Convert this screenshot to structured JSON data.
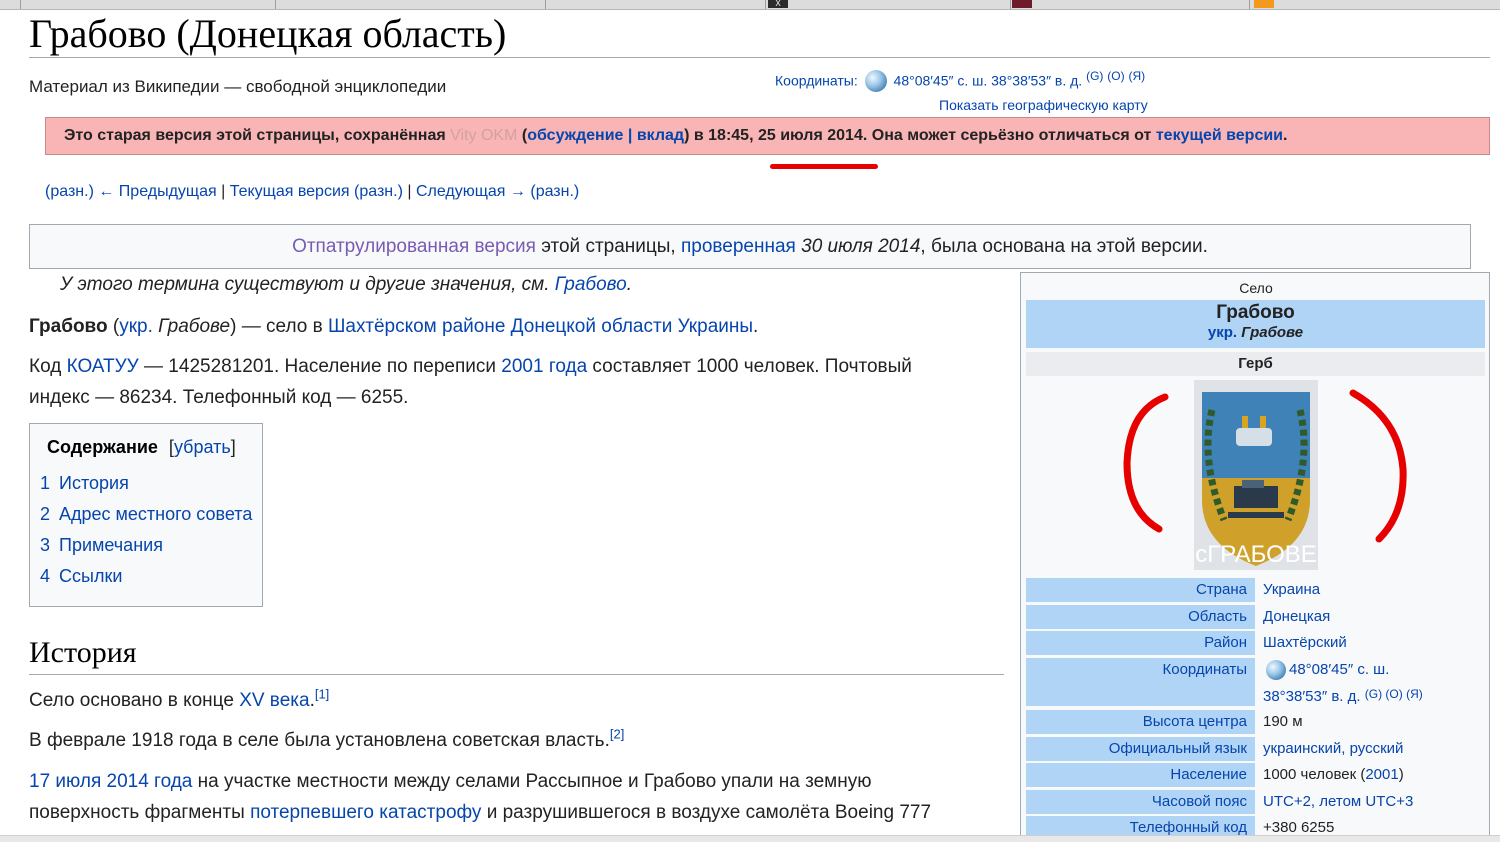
{
  "page": {
    "title": "Грабово (Донецкая область)",
    "subtitle": "Материал из Википедии — свободной энциклопедии"
  },
  "coords": {
    "label": "Координаты:",
    "value": "48°08′45″ с. ш. 38°38′53″ в. д.",
    "g": "(G)",
    "o": "(O)",
    "ya": "(Я)",
    "map_link": "Показать географическую карту"
  },
  "old_revision": {
    "prefix": "Это старая версия этой страницы, сохранённая",
    "user": "Vity OKM",
    "open_paren": " (",
    "talk": "обсуждение",
    "sep": " | ",
    "contribs": "вклад",
    "time_text": ") в 18:45, 25 июля 2014.",
    "middle": " Она может серьёзно отличаться от",
    "current_link": "текущей версии",
    "end": "."
  },
  "revision_nav": {
    "diff1": "(разн.)",
    "prev": "← Предыдущая",
    "sep1": "|",
    "current": "Текущая версия",
    "diff2": "(разн.)",
    "sep2": "|",
    "next": "Следующая →",
    "diff3": "(разн.)"
  },
  "patrol": {
    "link1": "Отпатрулированная версия",
    "text1": " этой страницы, ",
    "link2": "проверенная",
    "date": " 30 июля 2014",
    "text2": ", была основана на этой версии."
  },
  "hatnote": {
    "text": "У этого термина существуют и другие значения, см.",
    "link": "Грабово",
    "end": "."
  },
  "intro": {
    "bold": "Грабово",
    "paren_open": " (",
    "ukr_link": "укр.",
    "ukr_name": " Грабове",
    "paren_close": ") — село в ",
    "district": "Шахтёрском районе",
    "region": "Донецкой области",
    "country": "Украины",
    "end": "."
  },
  "codes": {
    "t1": "Код ",
    "koatuu": "КОАТУУ",
    "t2": " — 1425281201. Население по переписи ",
    "census": "2001 года",
    "t3": " составляет 1000 человек. Почтовый",
    "t4": "индекс — 86234. Телефонный код — 6255."
  },
  "toc": {
    "title": "Содержание",
    "toggle_open": "[",
    "toggle": "убрать",
    "toggle_close": "]",
    "items": [
      {
        "num": "1",
        "label": "История"
      },
      {
        "num": "2",
        "label": "Адрес местного совета"
      },
      {
        "num": "3",
        "label": "Примечания"
      },
      {
        "num": "4",
        "label": "Ссылки"
      }
    ]
  },
  "history": {
    "heading": "История",
    "p1_text": "Село основано в конце ",
    "p1_link": "XV века",
    "p1_end": ".",
    "ref1": "[1]",
    "p2_text": "В феврале 1918 года в селе была установлена советская власть.",
    "ref2": "[2]",
    "p3_link1": "17 июля 2014 года",
    "p3_text1": " на участке местности между селами Рассыпное и Грабово упали на земную",
    "p3_text2": "поверхность фрагменты ",
    "p3_link2": "потерпевшего катастрофу",
    "p3_text3": " и разрушившегося в воздухе самолёта Boeing 777"
  },
  "infobox": {
    "above": "Село",
    "name": "Грабово",
    "ukr_label": "укр.",
    "ukr_name": "Грабове",
    "gerb": "Герб",
    "coat_text": "сГРАБОВЕ",
    "rows": [
      {
        "label": "Страна",
        "value": "Украина"
      },
      {
        "label": "Область",
        "value": "Донецкая"
      },
      {
        "label": "Район",
        "value": "Шахтёрский"
      },
      {
        "label": "Координаты",
        "value": "48°08′45″ с. ш.",
        "value2": "38°38′53″ в. д.",
        "extra": "(G) (O) (Я)"
      },
      {
        "label": "Высота центра",
        "value": "190 м"
      },
      {
        "label": "Официальный язык",
        "value": "украинский, русский"
      },
      {
        "label": "Население",
        "value": "1000 человек (",
        "link": "2001",
        "end": ")"
      },
      {
        "label": "Часовой пояс",
        "value": "UTC+2, летом UTC+3"
      },
      {
        "label": "Телефонный код",
        "value": "+380 6255"
      }
    ]
  },
  "colors": {
    "link": "#0645ad",
    "old_notice_bg": "#f9b5b5",
    "infobox_header": "#b0d4f5",
    "annotation_red": "#e60000"
  }
}
